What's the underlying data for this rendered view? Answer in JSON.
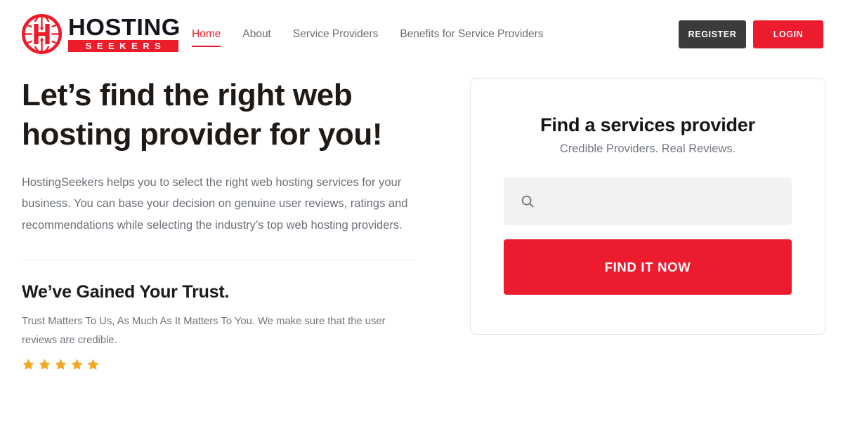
{
  "brand": {
    "logo_icon": "globe-h-logo-icon",
    "name_top": "HOSTING",
    "name_bottom": "SEEKERS",
    "primary_color": "#ed1b2e",
    "dark_color": "#3b3b3b"
  },
  "nav": {
    "items": [
      {
        "label": "Home",
        "active": true
      },
      {
        "label": "About",
        "active": false
      },
      {
        "label": "Service Providers",
        "active": false
      },
      {
        "label": "Benefits for Service Providers",
        "active": false
      }
    ]
  },
  "header_actions": {
    "register_label": "REGISTER",
    "login_label": "LOGIN"
  },
  "hero": {
    "title": "Let’s find the right web hosting provider for you!",
    "body": "HostingSeekers helps you to select the right web hosting services for your business. You can base your decision on genuine user reviews, ratings and recommendations while selecting the industry’s top web hosting providers."
  },
  "trust": {
    "title": "We’ve Gained Your Trust.",
    "body": "Trust Matters To Us, As Much As It Matters To You. We make sure that the user reviews are credible.",
    "rating": 5,
    "star_color": "#f0a823",
    "star_icon": "star-icon"
  },
  "search_card": {
    "title": "Find a services provider",
    "subtitle": "Credible Providers. Real Reviews.",
    "search_icon": "search-icon",
    "search_value": "",
    "search_placeholder": "",
    "submit_label": "FIND IT NOW"
  }
}
